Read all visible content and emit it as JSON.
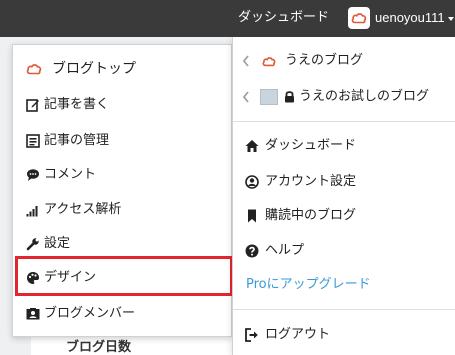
{
  "topbar": {
    "dashboard_label": "ダッシュボード",
    "username": "uenoyou111"
  },
  "background": {
    "blog_days_label": "ブログ日数"
  },
  "left_menu": {
    "items": [
      {
        "label": "ブログトップ",
        "icon": "blog-logo-icon"
      },
      {
        "label": "記事を書く",
        "icon": "edit-icon"
      },
      {
        "label": "記事の管理",
        "icon": "article-list-icon"
      },
      {
        "label": "コメント",
        "icon": "comment-icon"
      },
      {
        "label": "アクセス解析",
        "icon": "signal-icon"
      },
      {
        "label": "設定",
        "icon": "wrench-icon"
      },
      {
        "label": "デザイン",
        "icon": "palette-icon"
      },
      {
        "label": "ブログメンバー",
        "icon": "member-card-icon"
      }
    ],
    "highlighted": "デザイン"
  },
  "right_menu": {
    "blogs": [
      {
        "label": "うえのブログ",
        "icon": "blog-logo-icon"
      },
      {
        "label": "うえのお試しのブログ",
        "icon": "lock-icon"
      }
    ],
    "account_items": [
      {
        "label": "ダッシュボード",
        "icon": "home-icon"
      },
      {
        "label": "アカウント設定",
        "icon": "user-circle-icon"
      },
      {
        "label": "購読中のブログ",
        "icon": "bookmark-icon"
      },
      {
        "label": "ヘルプ",
        "icon": "question-icon"
      }
    ],
    "upgrade_label": "Proにアップグレード",
    "logout_label": "ログアウト"
  },
  "colors": {
    "topbar": "#3a3a3a",
    "highlight": "#e3262d",
    "pro_link": "#3a9ad9",
    "brand": "#e05a3a"
  }
}
